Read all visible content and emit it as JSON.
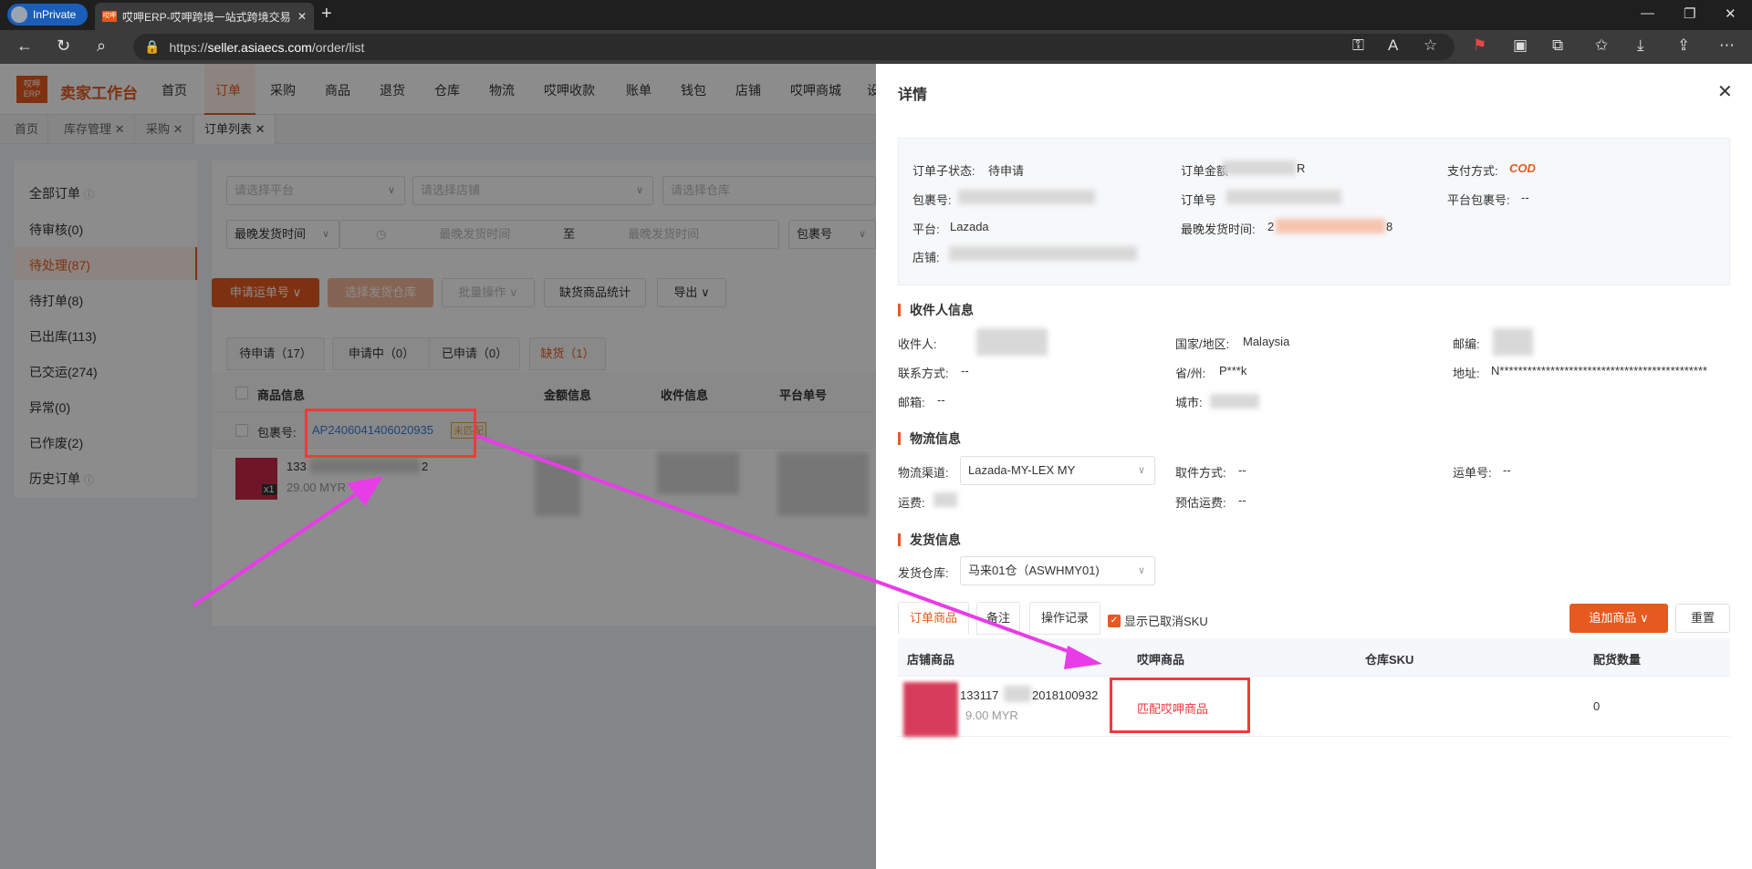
{
  "browser": {
    "profile_label": "InPrivate",
    "tab_favicon": "哎呷",
    "tab_title": "哎呷ERP-哎呷跨境一站式跨境交易",
    "url_scheme": "https://",
    "url_host": "seller.asiaecs.com",
    "url_path": "/order/list"
  },
  "app": {
    "logo_text": "哎呷\nERP",
    "title": "卖家工作台",
    "nav": [
      "首页",
      "订单",
      "采购",
      "商品",
      "退货",
      "仓库",
      "物流",
      "哎呷收款",
      "账单",
      "钱包",
      "店铺",
      "哎呷商城",
      "设"
    ],
    "active_nav": "订单",
    "page_tabs": [
      "首页",
      "库存管理",
      "采购",
      "订单列表"
    ],
    "accent_color": "#e65a1f"
  },
  "sidebar": {
    "items": [
      "全部订单",
      "待审核(0)",
      "待处理(87)",
      "待打单(8)",
      "已出库(113)",
      "已交运(274)",
      "异常(0)",
      "已作废(2)",
      "历史订单"
    ],
    "active": "待处理(87)"
  },
  "filters": {
    "platform_placeholder": "请选择平台",
    "shop_placeholder": "请选择店铺",
    "warehouse_placeholder": "请选择仓库",
    "time_type": "最晚发货时间",
    "start_placeholder": "最晚发货时间",
    "range_sep": "至",
    "end_placeholder": "最晚发货时间",
    "package_type": "包裹号"
  },
  "actions": {
    "apply_tracking": "申请运单号",
    "select_warehouse": "选择发货仓库",
    "batch": "批量操作",
    "shortage_stats": "缺货商品统计",
    "export": "导出"
  },
  "order_tabs": [
    "待申请（17）",
    "申请中（0）",
    "已申请（0）",
    "缺货（1）"
  ],
  "table_headers": [
    "商品信息",
    "金额信息",
    "收件信息",
    "平台单号"
  ],
  "order": {
    "package_label": "包裹号:",
    "package_no": "AP2406041406020935",
    "badge": "未匹配",
    "item_sku": "133",
    "item_sku_tail": "2",
    "price": "29.00 MYR",
    "qty": "x1",
    "amount_partial": "14"
  },
  "drawer": {
    "title": "详情",
    "info": {
      "sub_status_label": "订单子状态:",
      "sub_status": "待申请",
      "amount_label": "订单金额",
      "amount_tail": "R",
      "payment_label": "支付方式:",
      "payment": "COD",
      "package_label": "包裹号:",
      "order_no_label": "订单号",
      "platform_pkg_label": "平台包裹号:",
      "platform_pkg": "--",
      "platform_label": "平台:",
      "platform": "Lazada",
      "latest_ship_label": "最晚发货时间:",
      "latest_ship_head": "2",
      "latest_ship_tail": "8",
      "shop_label": "店铺:"
    },
    "recipient_section": "收件人信息",
    "recipient": {
      "name_label": "收件人:",
      "country_label": "国家/地区:",
      "country": "Malaysia",
      "zip_label": "邮编:",
      "contact_label": "联系方式:",
      "contact": "--",
      "state_label": "省/州:",
      "state": "P***k",
      "address_label": "地址:",
      "address": "N*********************************************",
      "email_label": "邮箱:",
      "email": "--",
      "city_label": "城市:"
    },
    "logistics_section": "物流信息",
    "logistics": {
      "channel_label": "物流渠道:",
      "channel": "Lazada-MY-LEX MY",
      "pickup_label": "取件方式:",
      "pickup": "--",
      "tracking_label": "运单号:",
      "tracking": "--",
      "freight_label": "运费:",
      "est_freight_label": "预估运费:",
      "est_freight": "--"
    },
    "shipping_section": "发货信息",
    "shipping": {
      "warehouse_label": "发货仓库:",
      "warehouse": "马来01仓（ASWHMY01)"
    },
    "tabs": [
      "订单商品",
      "备注",
      "操作记录"
    ],
    "show_cancelled": "显示已取消SKU",
    "add_goods": "追加商品",
    "reset": "重置",
    "table_headers": [
      "店铺商品",
      "哎呷商品",
      "仓库SKU",
      "配货数量"
    ],
    "row": {
      "sku_head": "133117",
      "sku_tail": "2018100932",
      "price": "9.00 MYR",
      "match_link": "匹配哎呷商品",
      "qty": "0"
    }
  },
  "colors": {
    "annotation_arrow": "#e83ce8",
    "highlight_box": "#f03a3a",
    "cod": "#e65a1f"
  }
}
